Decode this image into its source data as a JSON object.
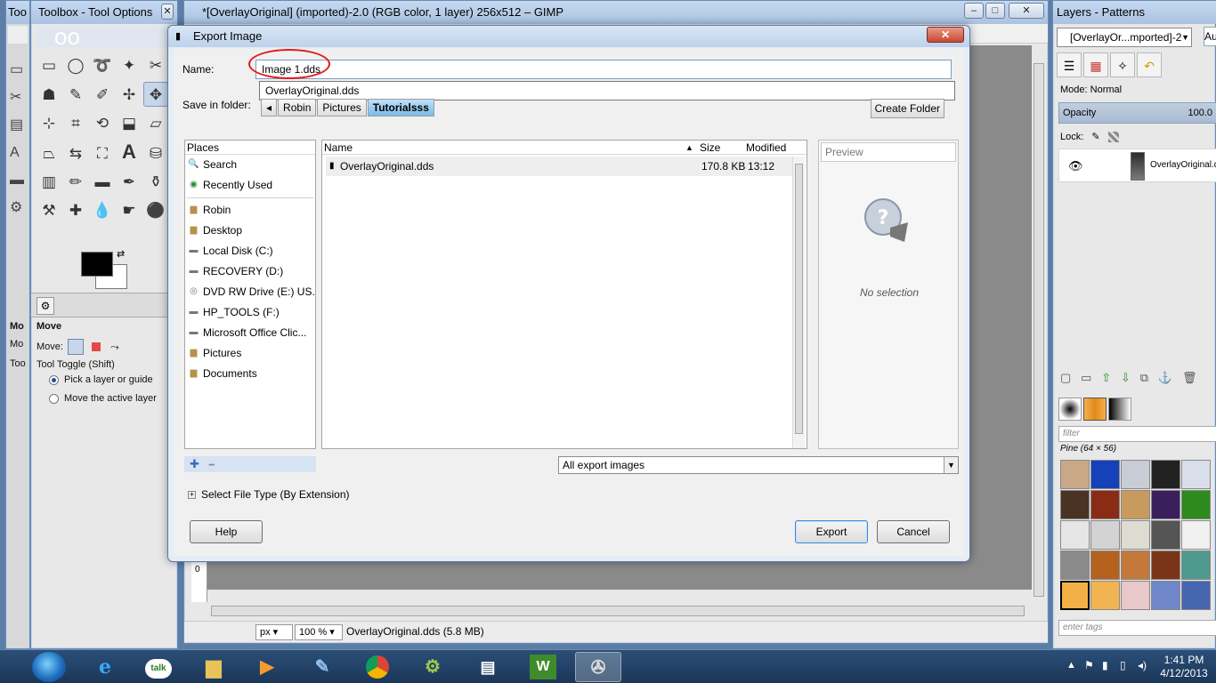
{
  "toolbox": {
    "strip_title": "Too",
    "title": "Toolbox - Tool Options",
    "active_tool": "Move",
    "move_label": "Move:",
    "toggle_label": "Tool Toggle  (Shift)",
    "option1": "Pick a layer or guide",
    "option2": "Move the active layer",
    "strip_labels": [
      "Mo",
      "Mo",
      "Too"
    ]
  },
  "main_window": {
    "title": "*[OverlayOriginal] (imported)-2.0 (RGB color, 1 layer) 256x512 – GIMP",
    "ruler_mark": "0",
    "unit": "px",
    "zoom": "100 %",
    "status": "OverlayOriginal.dds (5.8 MB)"
  },
  "layers_panel": {
    "title": "Layers - Patterns",
    "image_select": "[OverlayOr...mported]-2",
    "auto_button": "Aut",
    "mode_label": "Mode: Normal",
    "opacity_label": "Opacity",
    "opacity_value": "100.0",
    "lock_label": "Lock:",
    "layer_name": "OverlayOriginal.dds",
    "filter_placeholder": "filter",
    "pattern_name": "Pine (64 × 56)",
    "tags_placeholder": "enter tags"
  },
  "export_dialog": {
    "title": "Export Image",
    "name_label": "Name:",
    "name_value": "Image 1.dds",
    "autocomplete": "OverlayOriginal.dds",
    "folder_label": "Save in folder:",
    "breadcrumbs": [
      "Robin",
      "Pictures",
      "Tutorialsss"
    ],
    "create_folder": "Create Folder",
    "places_header": "Places",
    "places": [
      {
        "label": "Search",
        "icon": "search-icon"
      },
      {
        "label": "Recently Used",
        "icon": "clock-icon"
      },
      {
        "label": "Robin",
        "icon": "folder-icon"
      },
      {
        "label": "Desktop",
        "icon": "folder-icon"
      },
      {
        "label": "Local Disk (C:)",
        "icon": "drive-icon"
      },
      {
        "label": "RECOVERY (D:)",
        "icon": "drive-icon"
      },
      {
        "label": "DVD RW Drive (E:) US...",
        "icon": "disc-icon"
      },
      {
        "label": "HP_TOOLS (F:)",
        "icon": "drive-icon"
      },
      {
        "label": "Microsoft Office Clic...",
        "icon": "drive-icon"
      },
      {
        "label": "Pictures",
        "icon": "folder-icon"
      },
      {
        "label": "Documents",
        "icon": "folder-icon"
      }
    ],
    "columns": {
      "name": "Name",
      "size": "Size",
      "modified": "Modified"
    },
    "files": [
      {
        "name": "OverlayOriginal.dds",
        "size": "170.8 KB",
        "modified": "13:12"
      }
    ],
    "preview_header": "Preview",
    "no_selection": "No selection",
    "filter_value": "All export images",
    "file_type": "Select File Type (By Extension)",
    "help": "Help",
    "export": "Export",
    "cancel": "Cancel"
  },
  "taskbar": {
    "time": "1:41 PM",
    "date": "4/12/2013"
  }
}
